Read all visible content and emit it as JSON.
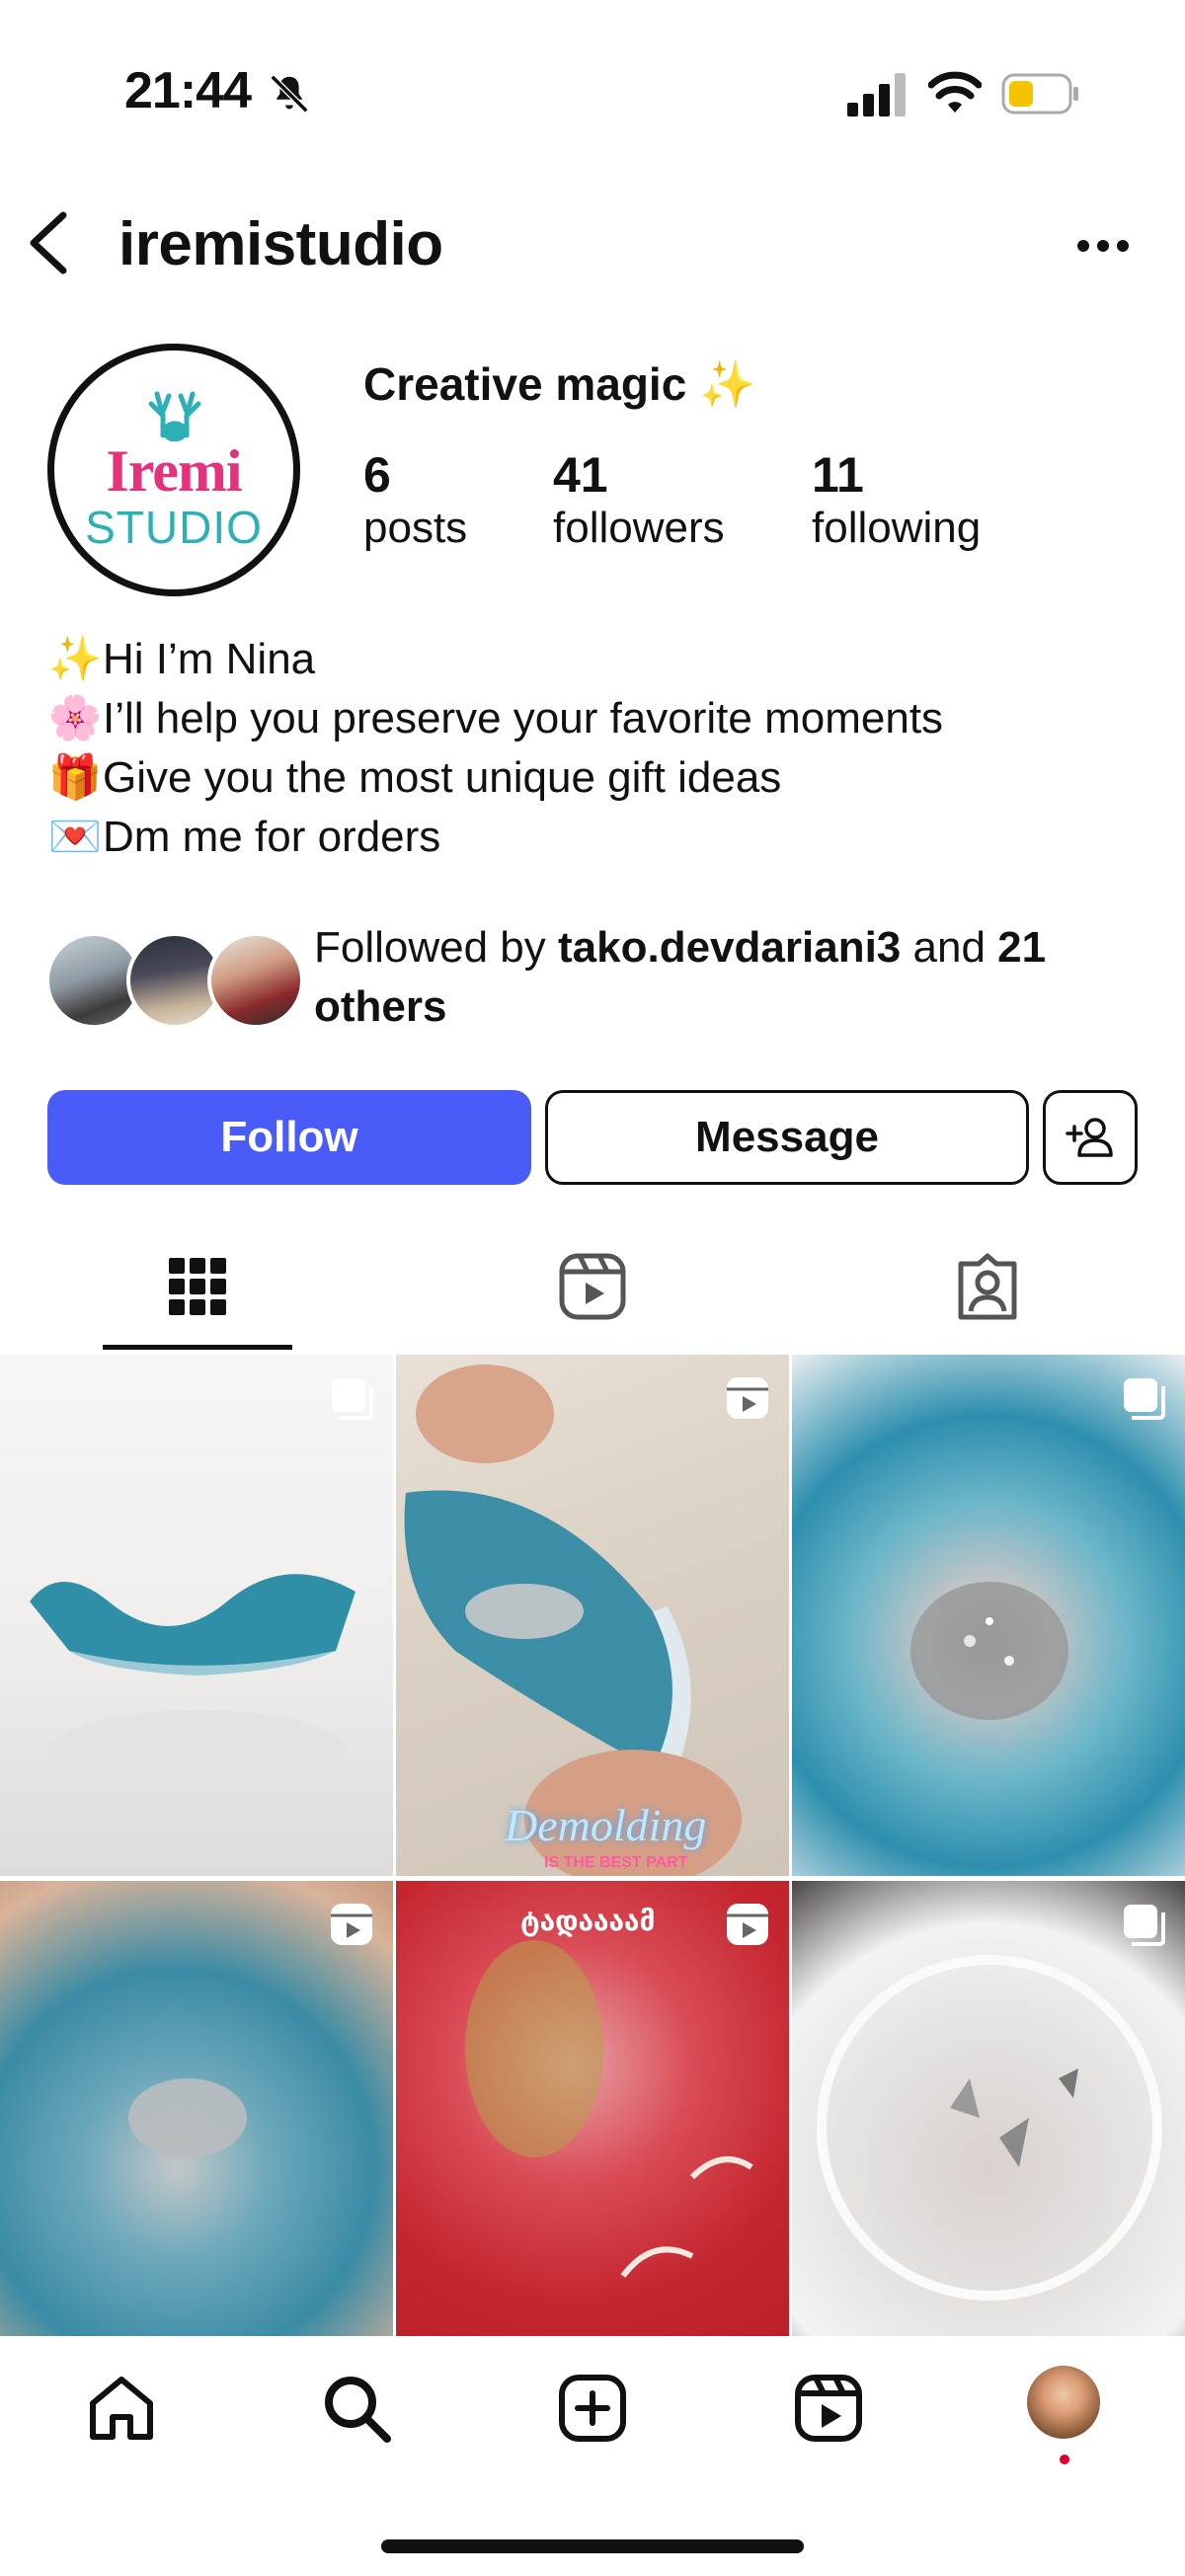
{
  "status_bar": {
    "time": "21:44",
    "icons": [
      "bell-slash-icon",
      "cellular-signal-icon",
      "wifi-icon",
      "battery-low-icon"
    ]
  },
  "header": {
    "username": "iremistudio",
    "back_icon": "chevron-left-icon",
    "more_icon": "more-horizontal-icon"
  },
  "profile": {
    "avatar_logo": {
      "line1": "Iremi",
      "line2": "STUDIO"
    },
    "name": "Creative magic ✨",
    "stats": [
      {
        "value": "6",
        "label": "posts"
      },
      {
        "value": "41",
        "label": "followers"
      },
      {
        "value": "11",
        "label": "following"
      }
    ],
    "bio": [
      {
        "emoji": "✨",
        "text": "Hi I’m Nina"
      },
      {
        "emoji": "🌸",
        "text": "I’ll help you preserve your favorite moments"
      },
      {
        "emoji": "🎁",
        "text": "Give you the most unique gift ideas"
      },
      {
        "emoji": "💌",
        "text": "Dm me for orders"
      }
    ],
    "followed_by": {
      "prefix": "Followed by ",
      "user": "tako.devdariani3",
      "middle": " and ",
      "count": "21",
      "suffix": "others"
    }
  },
  "actions": {
    "follow": "Follow",
    "message": "Message",
    "add_user_icon": "person-add-icon"
  },
  "tabs": [
    "grid-icon",
    "reels-icon",
    "tagged-icon"
  ],
  "grid": {
    "posts": [
      {
        "badge": "multiple-icon"
      },
      {
        "badge": "reel-icon",
        "overlay_text": "Demolding",
        "overlay_sub": "IS THE BEST PART"
      },
      {
        "badge": "multiple-icon"
      },
      {
        "badge": "reel-icon"
      },
      {
        "badge": "reel-icon",
        "overlay_text": "ტადაააამ"
      },
      {
        "badge": "multiple-icon"
      }
    ]
  },
  "bottom_nav": [
    "home-icon",
    "search-icon",
    "create-icon",
    "reels-icon",
    "profile-avatar"
  ],
  "colors": {
    "follow_button": "#4a5cf8",
    "logo_pink": "#e5327a",
    "logo_teal": "#2bb0b6",
    "notification_dot": "#e0002a"
  }
}
